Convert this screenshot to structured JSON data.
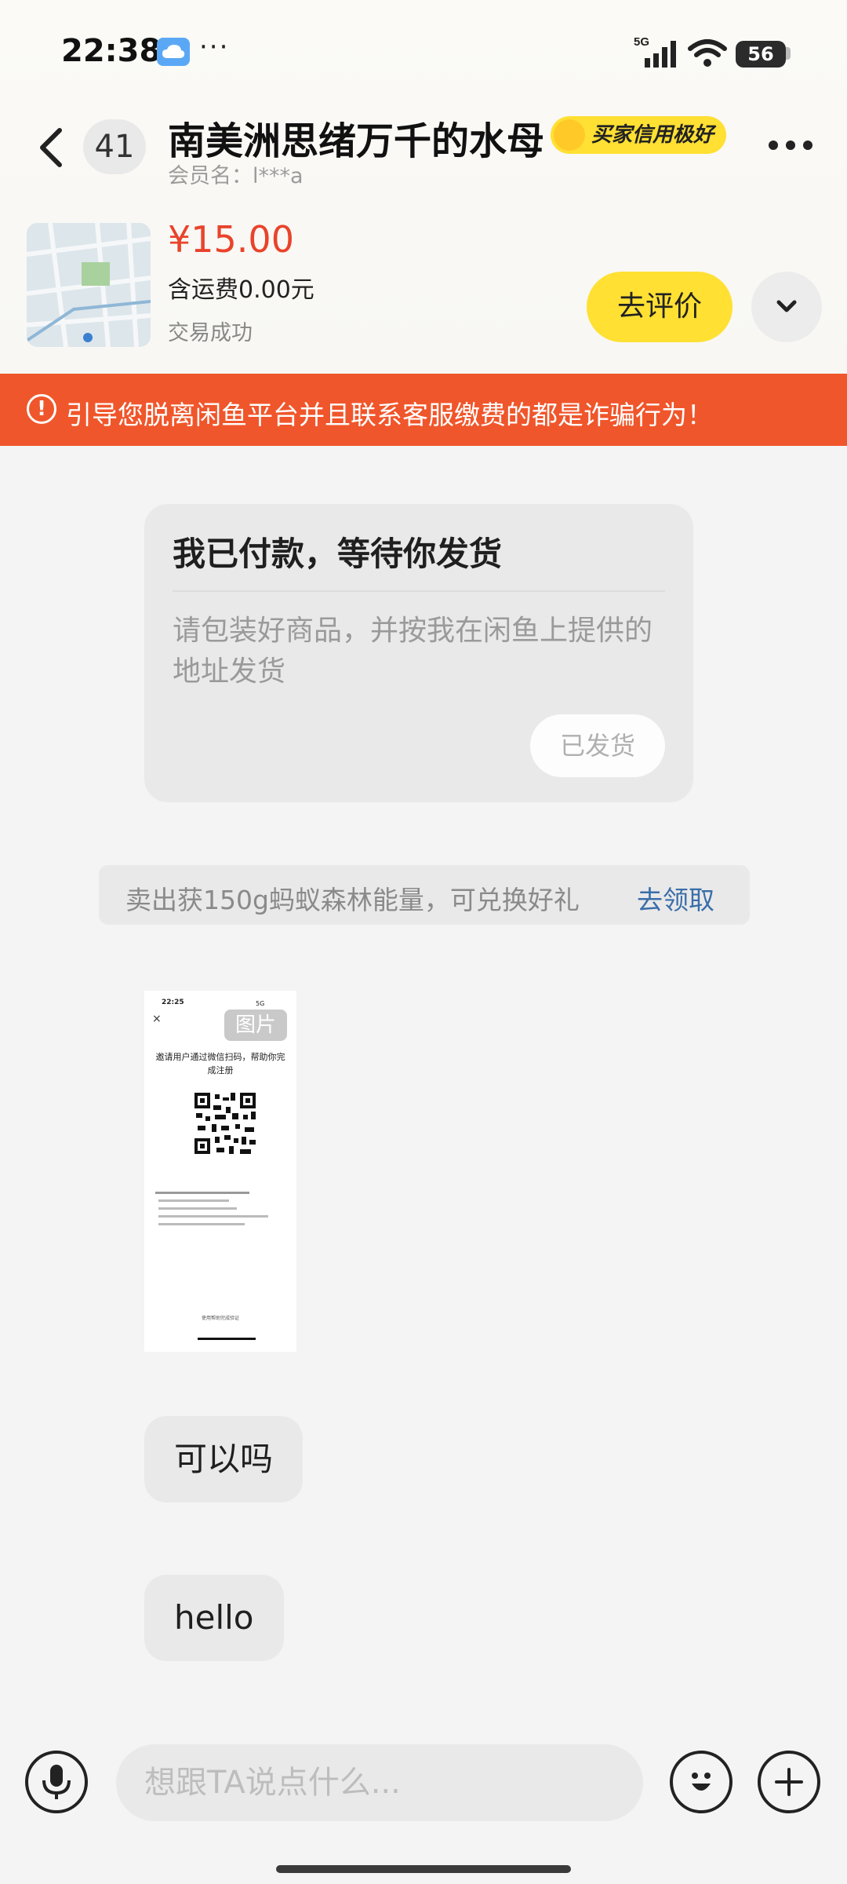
{
  "status_bar": {
    "time": "22:38",
    "more": "···",
    "network": "5G",
    "battery": "56"
  },
  "header": {
    "unread_count": "41",
    "title": "南美洲思绪万千的水母",
    "credit_badge": "买家信用极好",
    "member_name": "会员名：l***a"
  },
  "product": {
    "price": "¥15.00",
    "shipping": "含运费0.00元",
    "status": "交易成功",
    "review_button": "去评价"
  },
  "warning": {
    "icon": "!",
    "text": "引导您脱离闲鱼平台并且联系客服缴费的都是诈骗行为！"
  },
  "order_card": {
    "title": "我已付款，等待你发货",
    "description": "请包装好商品，并按我在闲鱼上提供的地址发货",
    "button": "已发货"
  },
  "promo": {
    "text": "卖出获150g蚂蚁森林能量，可兑换好礼",
    "link": "去领取"
  },
  "image_message": {
    "badge": "图片",
    "inner_time": "22:25",
    "inner_status": "5G",
    "inner_close": "×",
    "inner_heading": "邀请用户通过微信扫码，帮助你完成注册",
    "inner_footer": "使用帮助完成验证"
  },
  "messages": [
    {
      "text": "可以吗"
    },
    {
      "text": "hello"
    }
  ],
  "input": {
    "placeholder": "想跟TA说点什么..."
  },
  "colors": {
    "accent_yellow": "#ffe033",
    "price_red": "#e9432b",
    "warning_orange": "#f0562b",
    "link_blue": "#3a6ea8"
  },
  "icons": {
    "back": "chevron-left-icon",
    "more": "more-dots-icon",
    "expand": "chevron-down-icon",
    "mic": "microphone-icon",
    "emoji": "smiley-icon",
    "plus": "plus-icon"
  }
}
